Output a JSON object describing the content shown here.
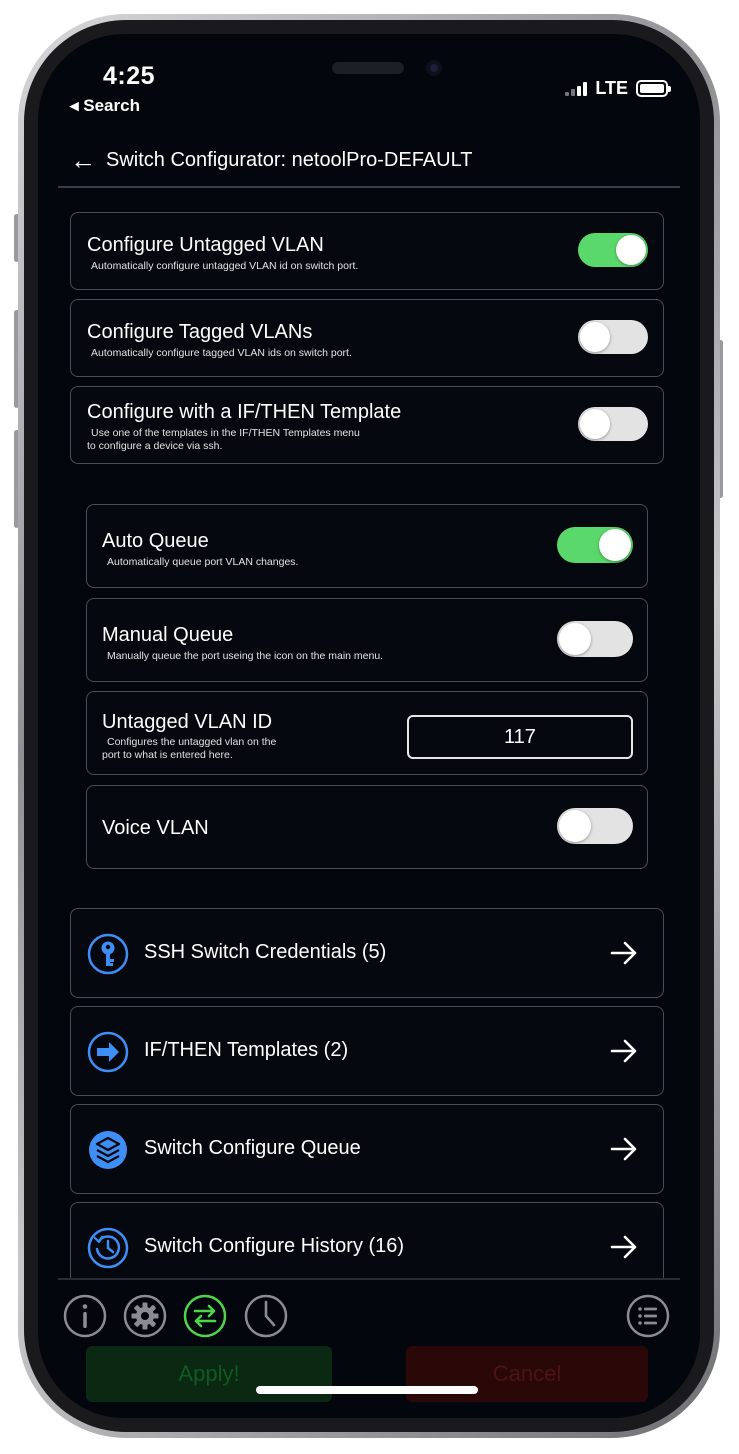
{
  "status": {
    "time": "4:25",
    "back_label": "◂ Search",
    "network": "LTE"
  },
  "nav": {
    "back_glyph": "←",
    "title": "Switch Configurator: netoolPro-DEFAULT"
  },
  "main_options": [
    {
      "title": "Configure Untagged VLAN",
      "subtitle": "Automatically configure untagged VLAN id on switch port.",
      "enabled": true
    },
    {
      "title": "Configure Tagged VLANs",
      "subtitle": "Automatically configure tagged VLAN ids on switch port.",
      "enabled": false
    },
    {
      "title": "Configure with a IF/THEN Template",
      "subtitle_line1": "Use one of the templates in the IF/THEN Templates menu",
      "subtitle_line2": "to configure a device via ssh.",
      "enabled": false
    }
  ],
  "sub_options": {
    "auto_queue": {
      "title": "Auto Queue",
      "subtitle": "Automatically queue port VLAN changes.",
      "enabled": true
    },
    "manual_queue": {
      "title": "Manual Queue",
      "subtitle": "Manually queue the port useing the icon on the main menu.",
      "enabled": false
    },
    "untagged_vlan_id": {
      "title": "Untagged VLAN ID",
      "subtitle_line1": "Configures the untagged vlan on the",
      "subtitle_line2": "port to what is entered here.",
      "value": "117"
    },
    "voice_vlan": {
      "title": "Voice VLAN",
      "enabled": false
    }
  },
  "links": [
    {
      "label": "SSH Switch Credentials (5)",
      "icon": "key-icon"
    },
    {
      "label": "IF/THEN Templates (2)",
      "icon": "arrow-circle-icon"
    },
    {
      "label": "Switch Configure Queue",
      "icon": "layers-icon"
    },
    {
      "label": "Switch Configure History (16)",
      "icon": "history-icon"
    }
  ],
  "footer": {
    "apply_label": "Apply!",
    "cancel_label": "Cancel"
  },
  "colors": {
    "accent_blue": "#3f8ef5",
    "toggle_on": "#5bd86b",
    "tab_active": "#4fd44a",
    "background": "#04060d"
  }
}
